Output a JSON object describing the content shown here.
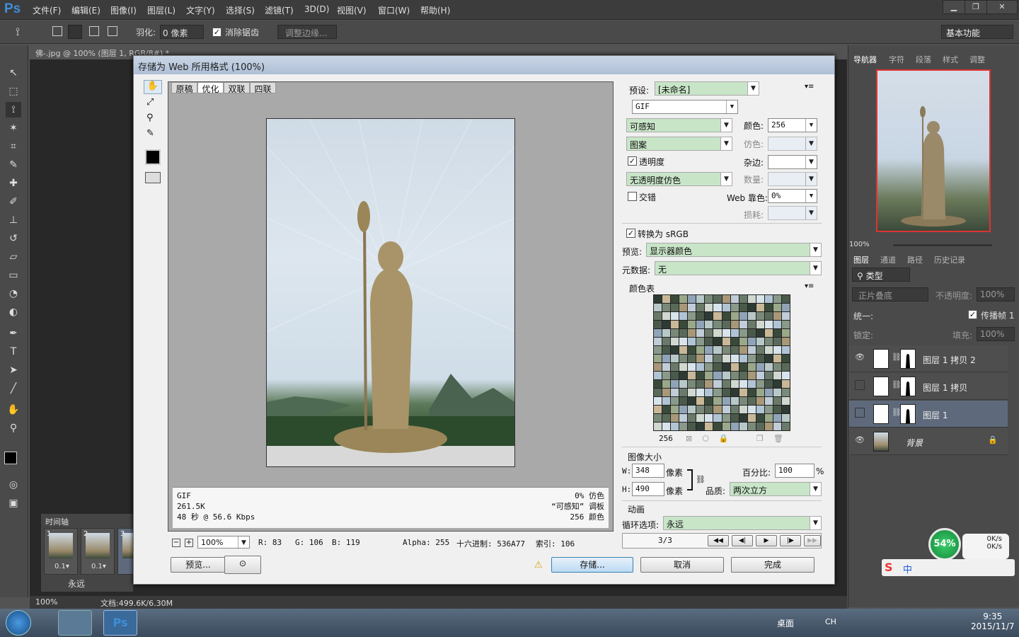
{
  "app": {
    "logo": "Ps"
  },
  "menu": [
    "文件(F)",
    "编辑(E)",
    "图像(I)",
    "图层(L)",
    "文字(Y)",
    "选择(S)",
    "滤镜(T)",
    "3D(D)",
    "视图(V)",
    "窗口(W)",
    "帮助(H)"
  ],
  "window_controls": {
    "minimize": "▁",
    "restore": "❐",
    "close": "✕"
  },
  "options": {
    "feather_label": "羽化:",
    "feather_value": "0 像素",
    "antialias_label": "消除锯齿",
    "refine_edge": "调整边缘...",
    "workspace": "基本功能"
  },
  "document": {
    "tab": "佛-.jpg @ 100% (图层 1, RGB/8#) *"
  },
  "timeline": {
    "title": "时间轴",
    "frames": [
      {
        "num": "1",
        "delay": "0.1▾"
      },
      {
        "num": "2",
        "delay": "0.1▾"
      },
      {
        "num": "3",
        "delay": ""
      }
    ],
    "loop": "永远"
  },
  "status": {
    "zoom": "100%",
    "doc": "文档:499.6K/6.30M"
  },
  "right_panel": {
    "tabs_top": [
      "导航器",
      "字符",
      "段落",
      "样式",
      "调整"
    ],
    "nav_zoom": "100%",
    "tabs_layers": [
      "图层",
      "通道",
      "路径",
      "历史记录"
    ],
    "kind": "类型",
    "blend": "正片叠底",
    "opacity_label": "不透明度:",
    "opacity": "100%",
    "unify": "统一:",
    "propagate": "传播帧 1",
    "lock": "锁定:",
    "fill_label": "填充:",
    "fill": "100%",
    "layers": [
      {
        "name": "图层 1 拷贝 2",
        "visible": "👁",
        "selected": false
      },
      {
        "name": "图层 1 拷贝",
        "visible": "",
        "selected": false
      },
      {
        "name": "图层 1",
        "visible": "",
        "selected": true
      },
      {
        "name": "背景",
        "visible": "👁",
        "selected": false,
        "locked": "🔒"
      }
    ]
  },
  "dialog": {
    "title": "存储为 Web 所用格式 (100%)",
    "view_tabs": [
      "原稿",
      "优化",
      "双联",
      "四联"
    ],
    "preset_label": "预设:",
    "preset": "[未命名]",
    "format": "GIF",
    "reduction": "可感知",
    "dither_algo": "图案",
    "transparency": "透明度",
    "transparency_dither": "无透明度仿色",
    "interlaced": "交错",
    "colors_label": "颜色:",
    "colors": "256",
    "dither_label": "仿色:",
    "matte_label": "杂边:",
    "amount_label": "数量:",
    "websnap_label": "Web 靠色:",
    "websnap": "0%",
    "lossy_label": "损耗:",
    "convert_srgb": "转换为 sRGB",
    "preview_label": "预览:",
    "preview_value": "显示器颜色",
    "metadata_label": "元数据:",
    "metadata_value": "无",
    "color_table_label": "颜色表",
    "color_count": "256",
    "image_size_label": "图像大小",
    "w_label": "W:",
    "w": "348",
    "h_label": "H:",
    "h": "490",
    "px": "像素",
    "percent_label": "百分比:",
    "percent": "100",
    "percent_unit": "%",
    "quality_label": "品质:",
    "quality": "两次立方",
    "animation_label": "动画",
    "loop_label": "循环选项:",
    "loop_value": "永远",
    "frame_counter": "3/3",
    "info_left": [
      "GIF",
      "261.5K",
      "48 秒 @ 56.6 Kbps"
    ],
    "info_right": [
      "0% 仿色",
      "“可感知” 调板",
      "256 颜色"
    ],
    "zoom": "100%",
    "readout": {
      "r": "R: 83",
      "g": "G: 106",
      "b": "B: 119",
      "alpha": "Alpha: 255",
      "hex": "十六进制: 536A77",
      "index": "索引: 106"
    },
    "buttons": {
      "preview": "预览...",
      "save": "存储...",
      "cancel": "取消",
      "done": "完成"
    }
  },
  "widget": {
    "percent": "54%",
    "up": "0K/s",
    "down": "0K/s"
  },
  "taskbar": {
    "desktop": "桌面",
    "lang": "CH",
    "time": "9:35",
    "date": "2015/11/7"
  },
  "colors": {
    "accent_green": "#c8e5c8",
    "selected_layer": "#5e6a7c",
    "ps_blue": "#3f8fd8"
  }
}
